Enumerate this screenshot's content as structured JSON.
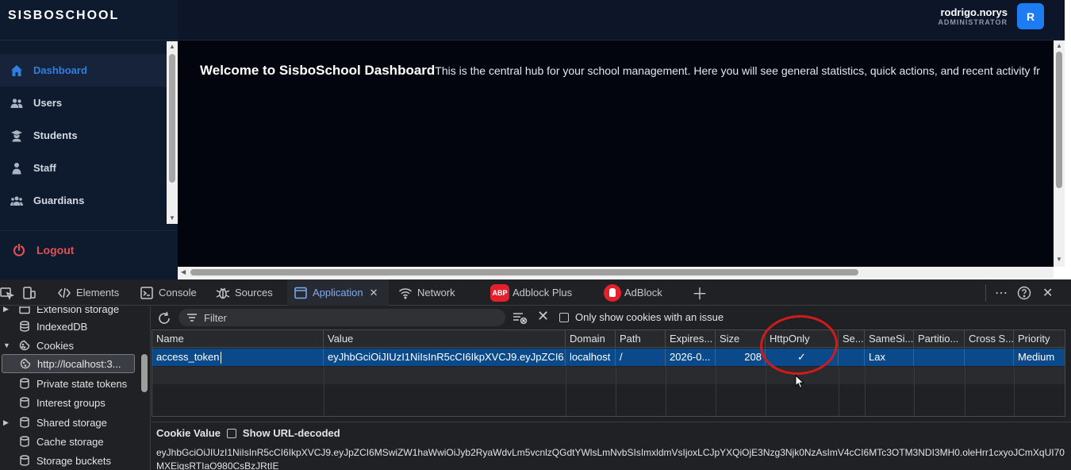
{
  "app": {
    "brand": "SISBOSCHOOL",
    "user": {
      "name": "rodrigo.norys",
      "role": "ADMINISTRATOR",
      "avatar_initial": "R"
    },
    "nav": [
      {
        "label": "Dashboard",
        "icon": "home-icon",
        "active": true
      },
      {
        "label": "Users",
        "icon": "users-icon",
        "active": false
      },
      {
        "label": "Students",
        "icon": "student-icon",
        "active": false
      },
      {
        "label": "Staff",
        "icon": "staff-icon",
        "active": false
      },
      {
        "label": "Guardians",
        "icon": "guardians-icon",
        "active": false
      }
    ],
    "logout_label": "Logout",
    "welcome_heading": "Welcome to SisboSchool Dashboard",
    "welcome_text": "This is the central hub for your school management. Here you will see general statistics, quick actions, and recent activity fr"
  },
  "devtools": {
    "tabs": [
      {
        "label": "Elements",
        "active": false
      },
      {
        "label": "Console",
        "active": false
      },
      {
        "label": "Sources",
        "active": false
      },
      {
        "label": "Application",
        "active": true
      },
      {
        "label": "Network",
        "active": false
      },
      {
        "label": "Adblock Plus",
        "active": false
      },
      {
        "label": "AdBlock",
        "active": false
      }
    ],
    "abp_badge": "ABP",
    "sidebar": [
      {
        "label": "Extension storage",
        "expandable": true
      },
      {
        "label": "IndexedDB",
        "expandable": false
      },
      {
        "label": "Cookies",
        "expandable": true,
        "expanded": true
      },
      {
        "label": "http://localhost:3...",
        "selected": true
      },
      {
        "label": "Private state tokens",
        "expandable": false
      },
      {
        "label": "Interest groups",
        "expandable": false
      },
      {
        "label": "Shared storage",
        "expandable": true
      },
      {
        "label": "Cache storage",
        "expandable": false
      },
      {
        "label": "Storage buckets",
        "expandable": false
      }
    ],
    "filter_placeholder": "Filter",
    "only_issue_label": "Only show cookies with an issue",
    "columns": [
      "Name",
      "Value",
      "Domain",
      "Path",
      "Expires...",
      "Size",
      "HttpOnly",
      "Se...",
      "SameSi...",
      "Partitio...",
      "Cross S...",
      "Priority"
    ],
    "cookie": {
      "name": "access_token",
      "value": "eyJhbGciOiJIUzI1NiIsInR5cCI6IkpXVCJ9.eyJpZCI6...",
      "domain": "localhost",
      "path": "/",
      "expires": "2026-0...",
      "size": "208",
      "httponly": "✓",
      "secure": "",
      "samesite": "Lax",
      "partition": "",
      "cross_site": "",
      "priority": "Medium"
    },
    "cookie_value_title": "Cookie Value",
    "show_url_decoded": "Show URL-decoded",
    "cookie_value_full": "eyJhbGciOiJIUzI1NiIsInR5cCI6IkpXVCJ9.eyJpZCI6MSwiZW1haWwiOiJyb2RyaWdvLm5vcnlzQGdtYWlsLmNvbSIsImxldmVsIjoxLCJpYXQiOjE3Nzg3Njk0NzAsImV4cCI6MTc3OTM3NDI3MH0.oleHrr1cxyoJCmXqUI70MXEiqsRTIaO980CsBzJRtIE"
  },
  "colors": {
    "accent": "#2f7fe0",
    "logout": "#e05252",
    "annotation": "#d11b1b",
    "selected_row": "#0b4a8a"
  }
}
